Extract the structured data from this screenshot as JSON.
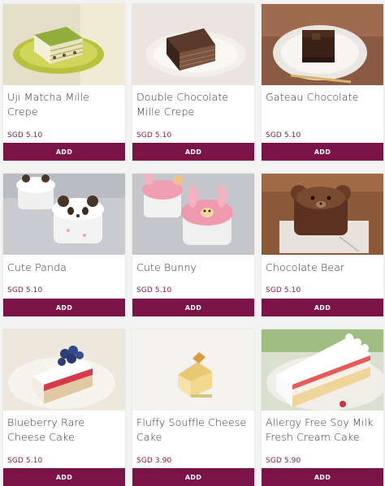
{
  "products": [
    {
      "name": "Uji Matcha Mille Crepe",
      "price": "SGD 5.10",
      "button": "ADD"
    },
    {
      "name": "Double Chocolate Mille Crepe",
      "price": "SGD 5.10",
      "button": "ADD"
    },
    {
      "name": "Gateau Chocolate",
      "price": "SGD 5.10",
      "button": "ADD"
    },
    {
      "name": "Cute Panda",
      "price": "SGD 5.10",
      "button": "ADD"
    },
    {
      "name": "Cute Bunny",
      "price": "SGD 5.10",
      "button": "ADD"
    },
    {
      "name": "Chocolate Bear",
      "price": "SGD 5.10",
      "button": "ADD"
    },
    {
      "name": "Blueberry Rare Cheese Cake",
      "price": "SGD 5.10",
      "button": "ADD"
    },
    {
      "name": "Fluffy Souffle Cheese Cake",
      "price": "SGD 3.90",
      "button": "ADD"
    },
    {
      "name": "Allergy Free Soy Milk Fresh Cream Cake",
      "price": "SGD 5.90",
      "button": "ADD"
    }
  ],
  "colors": {
    "accent": "#7b1346",
    "price": "#7a1a4c",
    "background": "#f3f3f3"
  }
}
